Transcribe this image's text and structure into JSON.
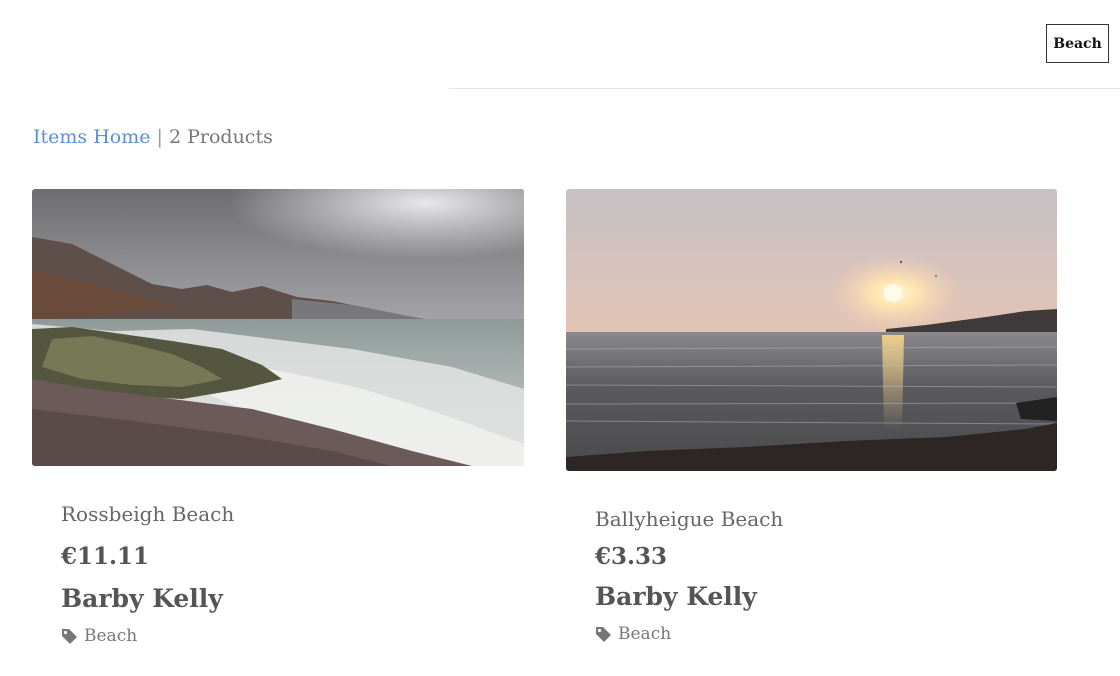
{
  "header": {
    "filter_button": "Beach"
  },
  "breadcrumb": {
    "home_link": "Items Home",
    "separator": "|",
    "count": "2 Products"
  },
  "products": [
    {
      "title": "Rossbeigh Beach",
      "price": "€11.11",
      "seller": "Barby Kelly",
      "tag": "Beach",
      "image": "stormy-beach-photo"
    },
    {
      "title": "Ballyheigue Beach",
      "price": "€3.33",
      "seller": "Barby Kelly",
      "tag": "Beach",
      "image": "sunset-beach-photo"
    }
  ],
  "colors": {
    "link": "#5b8fd6",
    "text": "#555555",
    "border": "#333333"
  }
}
